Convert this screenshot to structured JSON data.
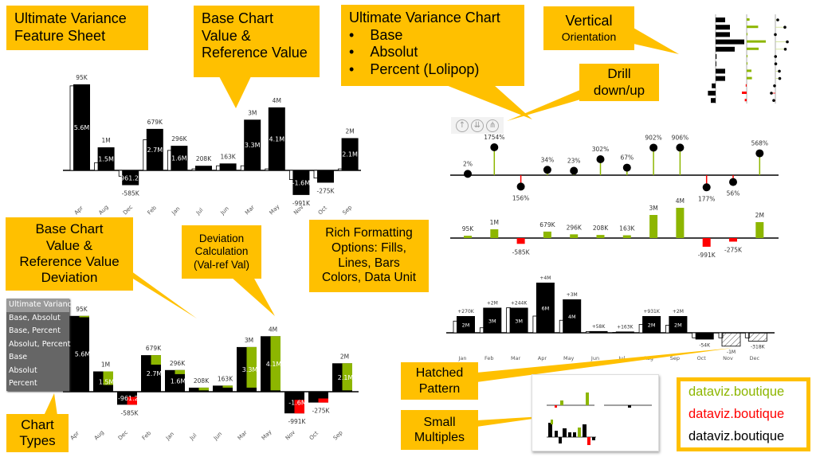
{
  "callouts": {
    "title": "Ultimate Variance Feature Sheet",
    "base_ref": [
      "Base Chart",
      "Value &",
      "Reference Value"
    ],
    "uv_chart": {
      "title": "Ultimate Variance Chart",
      "items": [
        "Base",
        "Absolut",
        "Percent (Lolipop)"
      ]
    },
    "vertical": [
      "Vertical",
      "Orientation"
    ],
    "drill": [
      "Drill",
      "down/up"
    ],
    "base_ref_dev": [
      "Base Chart",
      "Value &",
      "Reference Value",
      "Deviation"
    ],
    "dev_calc": [
      "Deviation",
      "Calculation",
      "(Val-ref Val)"
    ],
    "rich": [
      "Rich Formatting",
      "Options: Fills,",
      "Lines, Bars",
      "Colors, Data Unit"
    ],
    "chart_types": [
      "Chart",
      "Types"
    ],
    "hatched": [
      "Hatched",
      "Pattern"
    ],
    "small_multiples": [
      "Small",
      "Multiples"
    ]
  },
  "chart_types_menu": [
    "Ultimate Variance",
    "Base, Absolut",
    "Base, Percent",
    "Absolut, Percent",
    "Base",
    "Absolut",
    "Percent"
  ],
  "chart_types_selected": "Ultimate Variance",
  "drill_icons": [
    "drill-up-icon",
    "drill-down-icon",
    "expand-hierarchy-icon"
  ],
  "brand": [
    {
      "text": "dataviz.boutique",
      "color": "#8db600"
    },
    {
      "text": "dataviz.boutique",
      "color": "#ff0000"
    },
    {
      "text": "dataviz.boutique",
      "color": "#000000"
    }
  ],
  "colors": {
    "accent": "#ffc000",
    "positive": "#8db600",
    "negative": "#ff0000",
    "bar": "#000000"
  },
  "chart_data": [
    {
      "type": "bar",
      "name": "base-reference",
      "categories": [
        "Apr",
        "Aug",
        "Dec",
        "Feb",
        "Jan",
        "Jul",
        "Jun",
        "Mar",
        "May",
        "Nov",
        "Oct",
        "Sep"
      ],
      "values": [
        5.6,
        1.5,
        -0.9612,
        2.7,
        1.6,
        0.3,
        0.45,
        3.3,
        4.1,
        -1.6,
        -0.8,
        2.1
      ],
      "reference": [
        5.5,
        0.5,
        -0.38,
        2.0,
        1.3,
        0.1,
        0.3,
        0.3,
        0.1,
        -0.6,
        -0.5,
        0.1
      ],
      "value_labels": [
        "5.6M",
        "1.5M",
        "-961.2K",
        "2.7M",
        "1.6M",
        "",
        "",
        "3.3M",
        "4.1M",
        "-1.6M",
        "",
        ""
      ],
      "value_labels_extra": {
        "11": "2.1M"
      },
      "deviation_labels": [
        "95K",
        "1M",
        "-585K",
        "679K",
        "296K",
        "208K",
        "163K",
        "3M",
        "4M",
        "-991K",
        "-275K",
        "2M"
      ]
    },
    {
      "type": "bar",
      "name": "base-deviation",
      "categories": [
        "Apr",
        "Aug",
        "Dec",
        "Feb",
        "Jan",
        "Jul",
        "Jun",
        "Mar",
        "May",
        "Nov",
        "Oct",
        "Sep"
      ],
      "values": [
        5.6,
        1.5,
        -0.9612,
        2.7,
        1.6,
        0.3,
        0.45,
        3.3,
        4.1,
        -1.6,
        -0.8,
        2.1
      ],
      "reference": [
        5.5,
        0.5,
        -0.38,
        2.0,
        1.3,
        0.1,
        0.3,
        0.3,
        0.1,
        -0.6,
        -0.5,
        0.1
      ],
      "value_labels": [
        "5.6M",
        "1.5M",
        "-961.2K",
        "2.7M",
        "1.6M",
        "",
        "",
        "3.3M",
        "4.1M",
        "-1.6M",
        "",
        "2.1M"
      ],
      "deviation_labels": [
        "95K",
        "1M",
        "-585K",
        "679K",
        "296K",
        "208K",
        "163K",
        "3M",
        "4M",
        "-991K",
        "-275K",
        "2M"
      ]
    },
    {
      "type": "lollipop",
      "name": "percent-deviation",
      "values": [
        2,
        1754,
        -156,
        34,
        23,
        302,
        67,
        902,
        906,
        -177,
        -56,
        568
      ],
      "labels": [
        "2%",
        "1754%",
        "156%",
        "34%",
        "23%",
        "302%",
        "67%",
        "902%",
        "906%",
        "177%",
        "56%",
        "568%"
      ]
    },
    {
      "type": "bar",
      "name": "absolute-deviation",
      "values": [
        95,
        1000,
        -585,
        679,
        296,
        208,
        163,
        3000,
        4000,
        -991,
        -275,
        2000
      ],
      "labels": [
        "95K",
        "1M",
        "-585K",
        "679K",
        "296K",
        "208K",
        "163K",
        "3M",
        "4M",
        "-991K",
        "-275K",
        "2M"
      ]
    },
    {
      "type": "bar",
      "name": "hatched-variance",
      "categories": [
        "Jan",
        "Feb",
        "Mar",
        "Apr",
        "May",
        "Jun",
        "Jul",
        "Aug",
        "Sep",
        "Oct",
        "Nov",
        "Dec"
      ],
      "values": [
        2,
        3,
        3,
        6,
        4,
        0.2,
        0.15,
        2,
        2,
        -0.8,
        -1.6,
        -1.0
      ],
      "reference": [
        1.4,
        0.6,
        3.0,
        2.0,
        1.5,
        0.15,
        0.05,
        1.0,
        0.9,
        -0.6,
        -0.6,
        -0.6
      ],
      "hatched": [
        false,
        false,
        false,
        false,
        false,
        false,
        false,
        false,
        false,
        false,
        true,
        true
      ],
      "value_labels": [
        "2M",
        "3M",
        "3M",
        "6M",
        "4M",
        "",
        "",
        "2M",
        "2M",
        "",
        "",
        ""
      ],
      "deviation_labels": [
        "+270K",
        "+2M",
        "+244K",
        "+4M",
        "+3M",
        "+58K",
        "+163K",
        "+931K",
        "+2M",
        "-54K",
        "-1M",
        "-318K"
      ]
    }
  ]
}
